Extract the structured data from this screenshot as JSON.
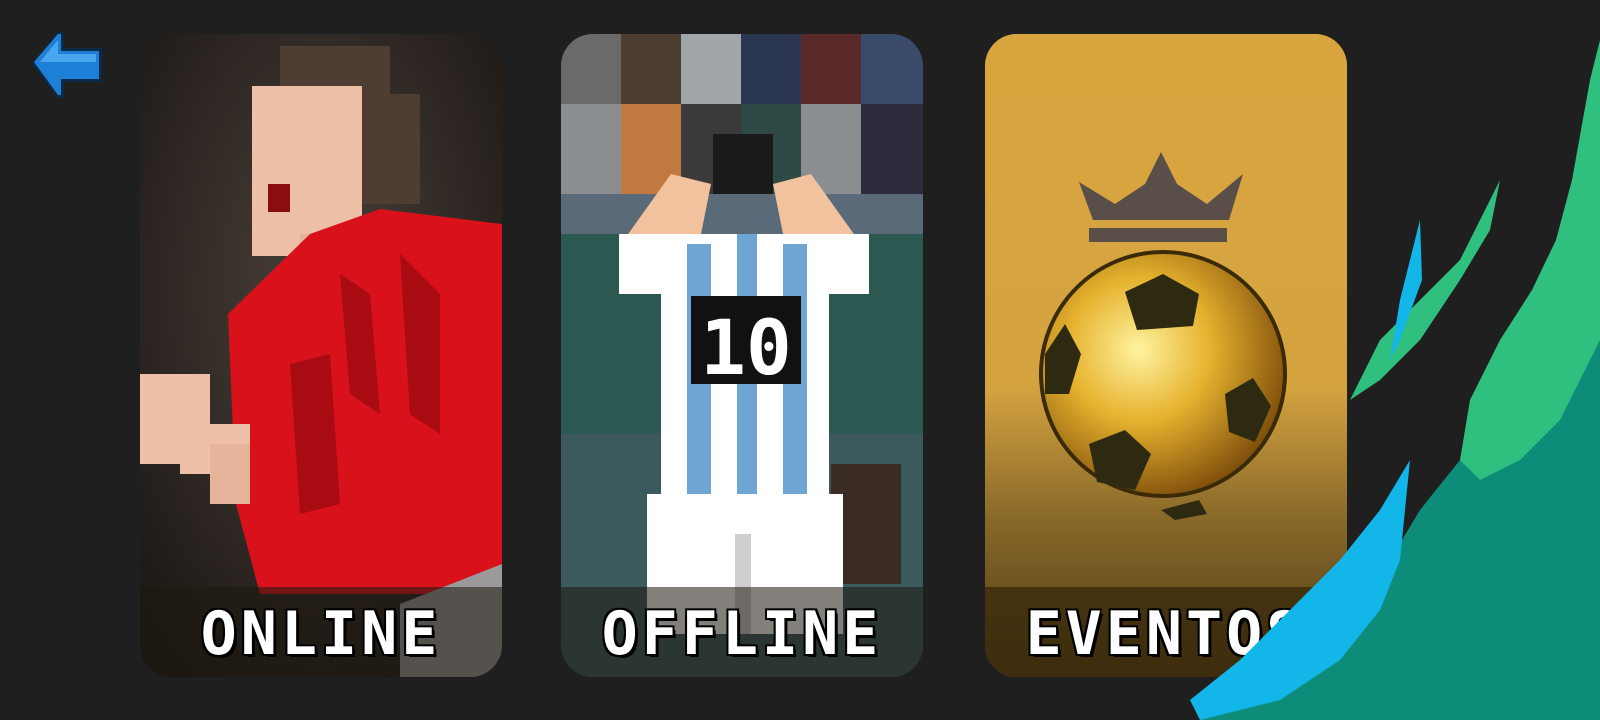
{
  "screen": "mode-select",
  "back_button": {
    "icon": "arrow-left-icon",
    "color": "#1e7fd6"
  },
  "cards": {
    "online": {
      "label": "ONLINE",
      "icon": "red-player-celebrating"
    },
    "offline": {
      "label": "OFFLINE",
      "icon": "number-10-player",
      "shirt_number": "10"
    },
    "events": {
      "label": "EVENTOS",
      "icon": "golden-ball-crown"
    }
  },
  "colors": {
    "background": "#1f1f1f",
    "events_card": "#d8a63e",
    "online_shirt": "#d8111b",
    "deco_green": "#2fbf7e",
    "deco_blue": "#12b6e8"
  }
}
